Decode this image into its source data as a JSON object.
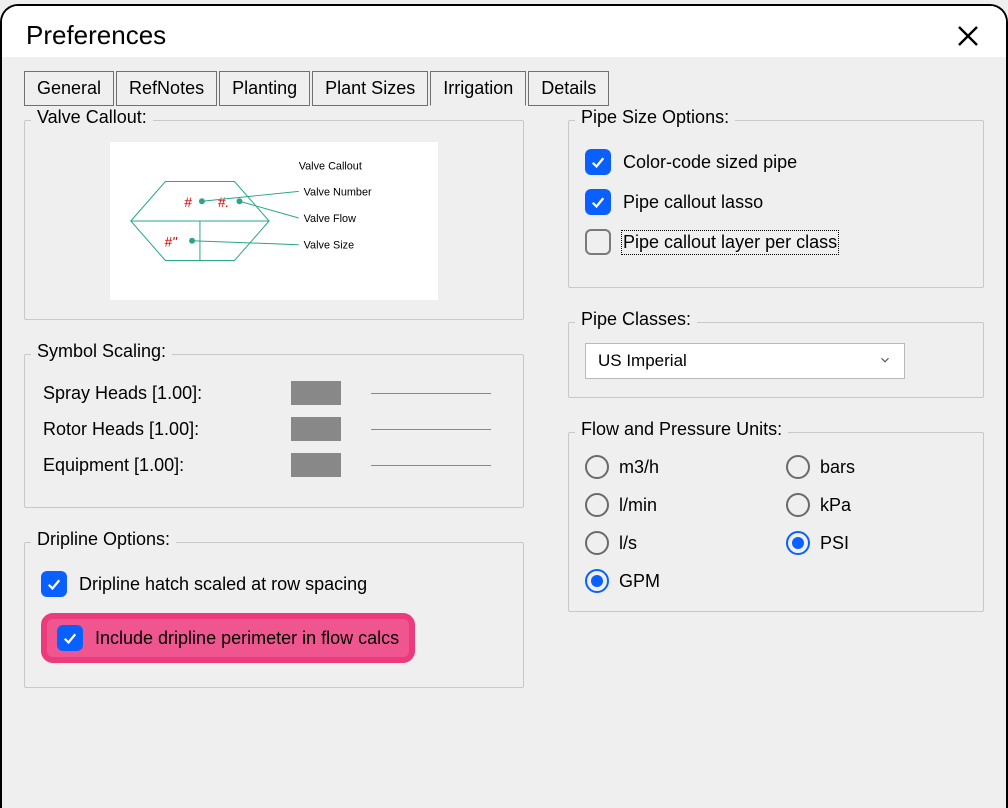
{
  "window": {
    "title": "Preferences"
  },
  "tabs": {
    "general": "General",
    "refnotes": "RefNotes",
    "planting": "Planting",
    "plant_sizes": "Plant Sizes",
    "irrigation": "Irrigation",
    "details": "Details",
    "active": "irrigation"
  },
  "valve_callout": {
    "group": "Valve Callout:",
    "title": "Valve Callout",
    "lbl_number": "Valve Number",
    "lbl_flow": "Valve Flow",
    "lbl_size": "Valve Size",
    "placeholder_hash": "#",
    "placeholder_hash_dot": "#.",
    "placeholder_hash_quote": "#\""
  },
  "symbol_scaling": {
    "group": "Symbol Scaling:",
    "spray": "Spray Heads [1.00]:",
    "rotor": "Rotor Heads [1.00]:",
    "equip": "Equipment [1.00]:"
  },
  "dripline": {
    "group": "Dripline Options:",
    "hatch": "Dripline hatch scaled at row spacing",
    "perim": "Include dripline perimeter in flow calcs"
  },
  "pipe_size": {
    "group": "Pipe Size Options:",
    "color": "Color-code sized pipe",
    "lasso": "Pipe callout lasso",
    "layer": "Pipe callout layer per class"
  },
  "pipe_classes": {
    "group": "Pipe Classes:",
    "value": "US Imperial"
  },
  "flow_pressure": {
    "group": "Flow and Pressure Units:",
    "m3h": "m3/h",
    "lmin": "l/min",
    "ls": "l/s",
    "gpm": "GPM",
    "bars": "bars",
    "kpa": "kPa",
    "psi": "PSI",
    "flow_selected": "GPM",
    "pressure_selected": "PSI"
  }
}
